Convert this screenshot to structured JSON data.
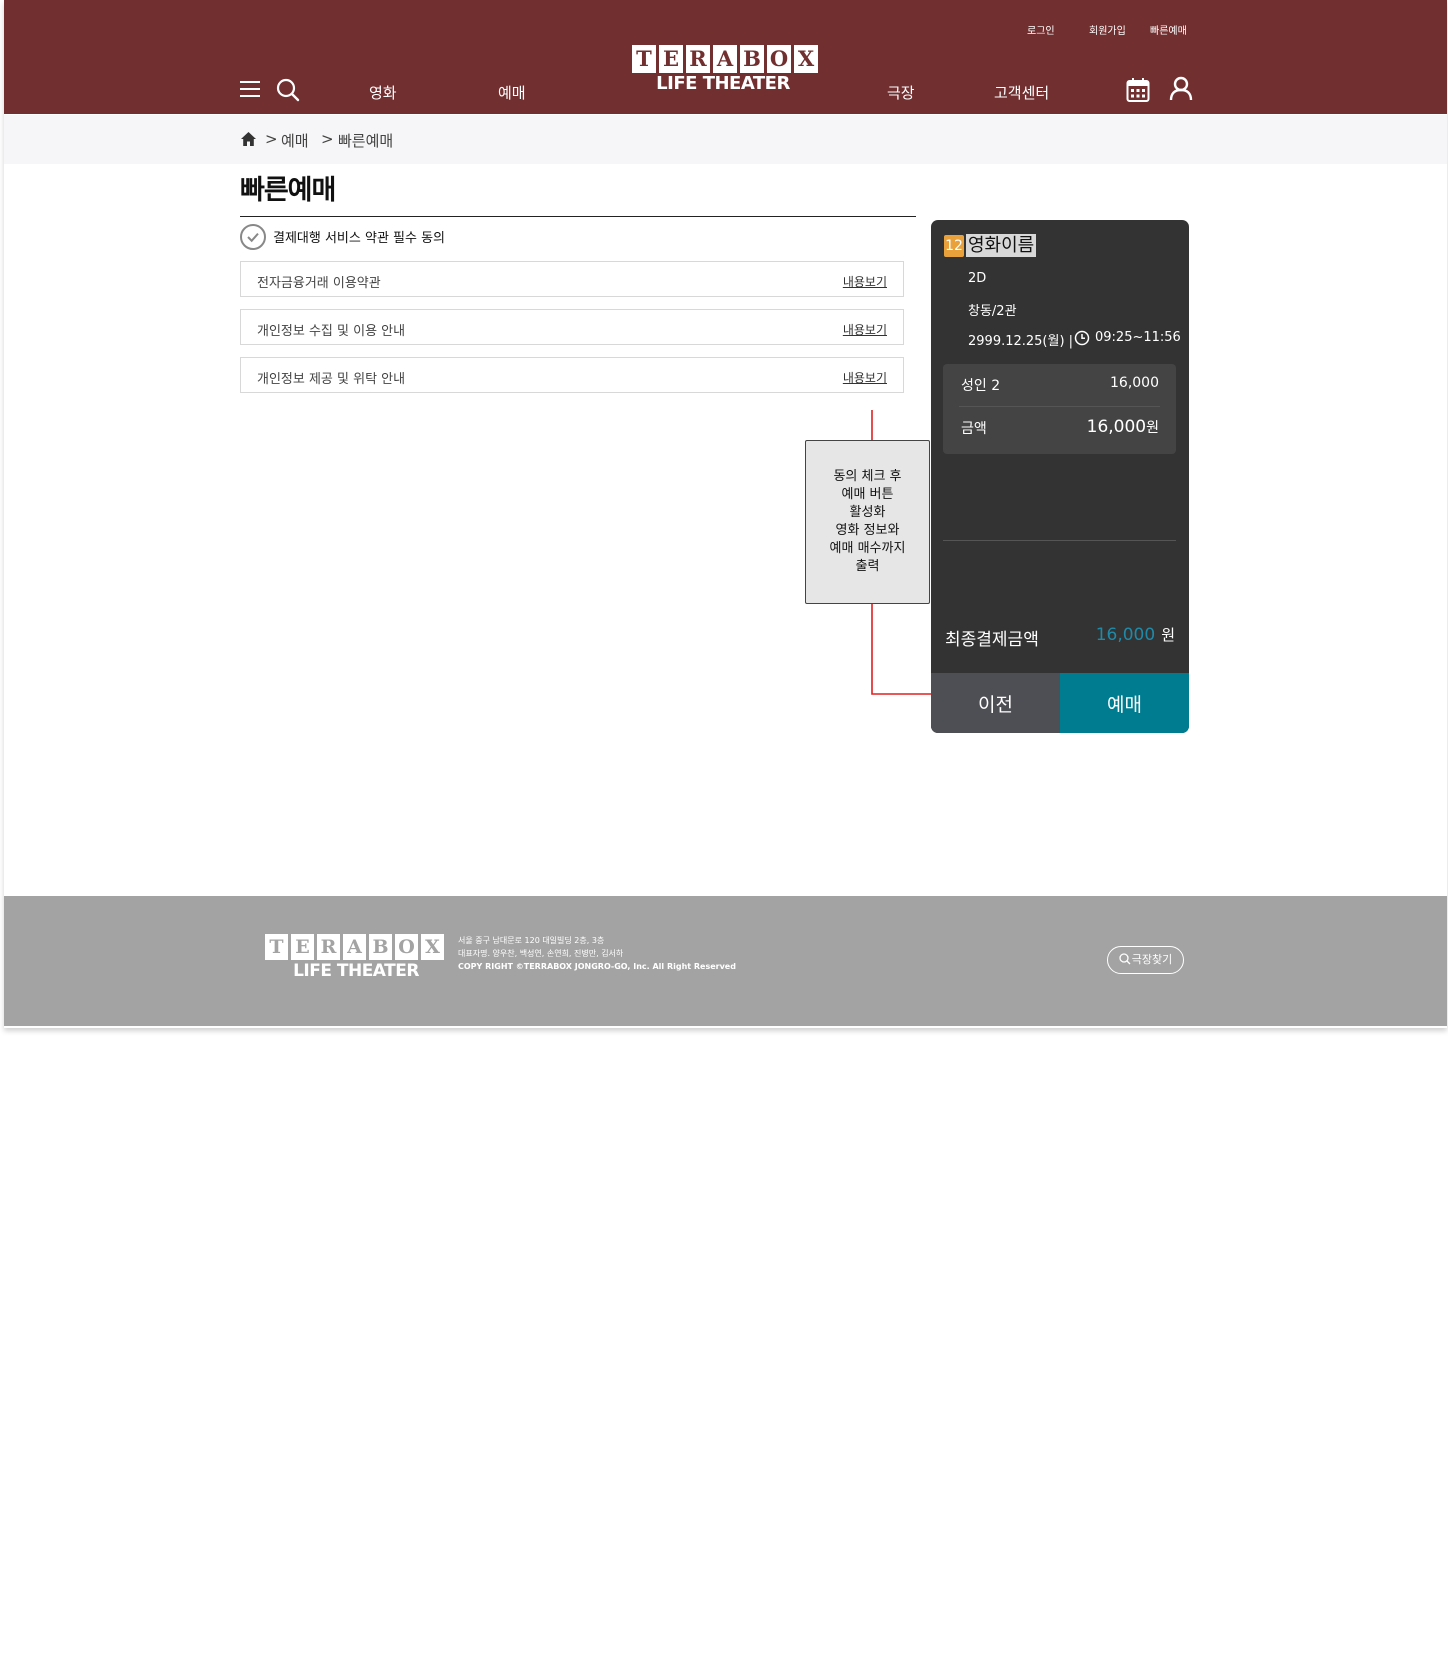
{
  "header": {
    "util_links": [
      "로그인",
      "회원가입",
      "빠른예매"
    ],
    "nav": [
      "영화",
      "예매",
      "극장",
      "고객센터"
    ],
    "logo": {
      "letters": [
        "T",
        "E",
        "R",
        "A",
        "B",
        "O",
        "X"
      ],
      "subtitle": "LIFE THEATER"
    },
    "icons": [
      "menu-icon",
      "search-icon",
      "calendar-icon",
      "user-icon"
    ],
    "color": "#722f30"
  },
  "breadcrumb": {
    "items": [
      "예매",
      "빠른예매"
    ],
    "separator": ">"
  },
  "page_title": "빠른예매",
  "agreement": {
    "all_label": "결제대행 서비스 약관 필수 동의",
    "terms": [
      {
        "label": "전자금융거래 이용약관",
        "link": "내용보기"
      },
      {
        "label": "개인정보 수집 및 이용 안내",
        "link": "내용보기"
      },
      {
        "label": "개인정보 제공 및 위탁 안내",
        "link": "내용보기"
      }
    ]
  },
  "annotation": {
    "text": "동의 체크 후\n예매 버튼\n활성화\n영화 정보와\n예매 매수까지\n출력",
    "arrow_color": "#e02020"
  },
  "summary": {
    "rating": "12",
    "rating_color": "#e9a23b",
    "movie_title": "영화이름",
    "format": "2D",
    "theater": "창동/2관",
    "date": "2999.12.25(월) |",
    "time": "09:25~11:56",
    "ticket_label": "성인 2",
    "ticket_price": "16,000",
    "amount_label": "금액",
    "amount_value": "16,000",
    "amount_unit": "원",
    "final_label": "최종결제금액",
    "final_value": "16,000",
    "final_unit": "원",
    "prev_button": "이전",
    "book_button": "예매",
    "accent_color": "#007c91"
  },
  "footer": {
    "logo": {
      "letters": [
        "T",
        "E",
        "R",
        "A",
        "B",
        "O",
        "X"
      ],
      "subtitle": "LIFE THEATER"
    },
    "address": "서울 중구 남대문로 120 대일빌딩 2층, 3층",
    "representatives": "대표자명. 양우찬, 백성연, 손연희, 진병만, 김서하",
    "copyright": "COPY RIGHT ©TERRABOX JONGRO-GO, Inc. All Right Reserved",
    "find_theater": "극장찾기"
  }
}
